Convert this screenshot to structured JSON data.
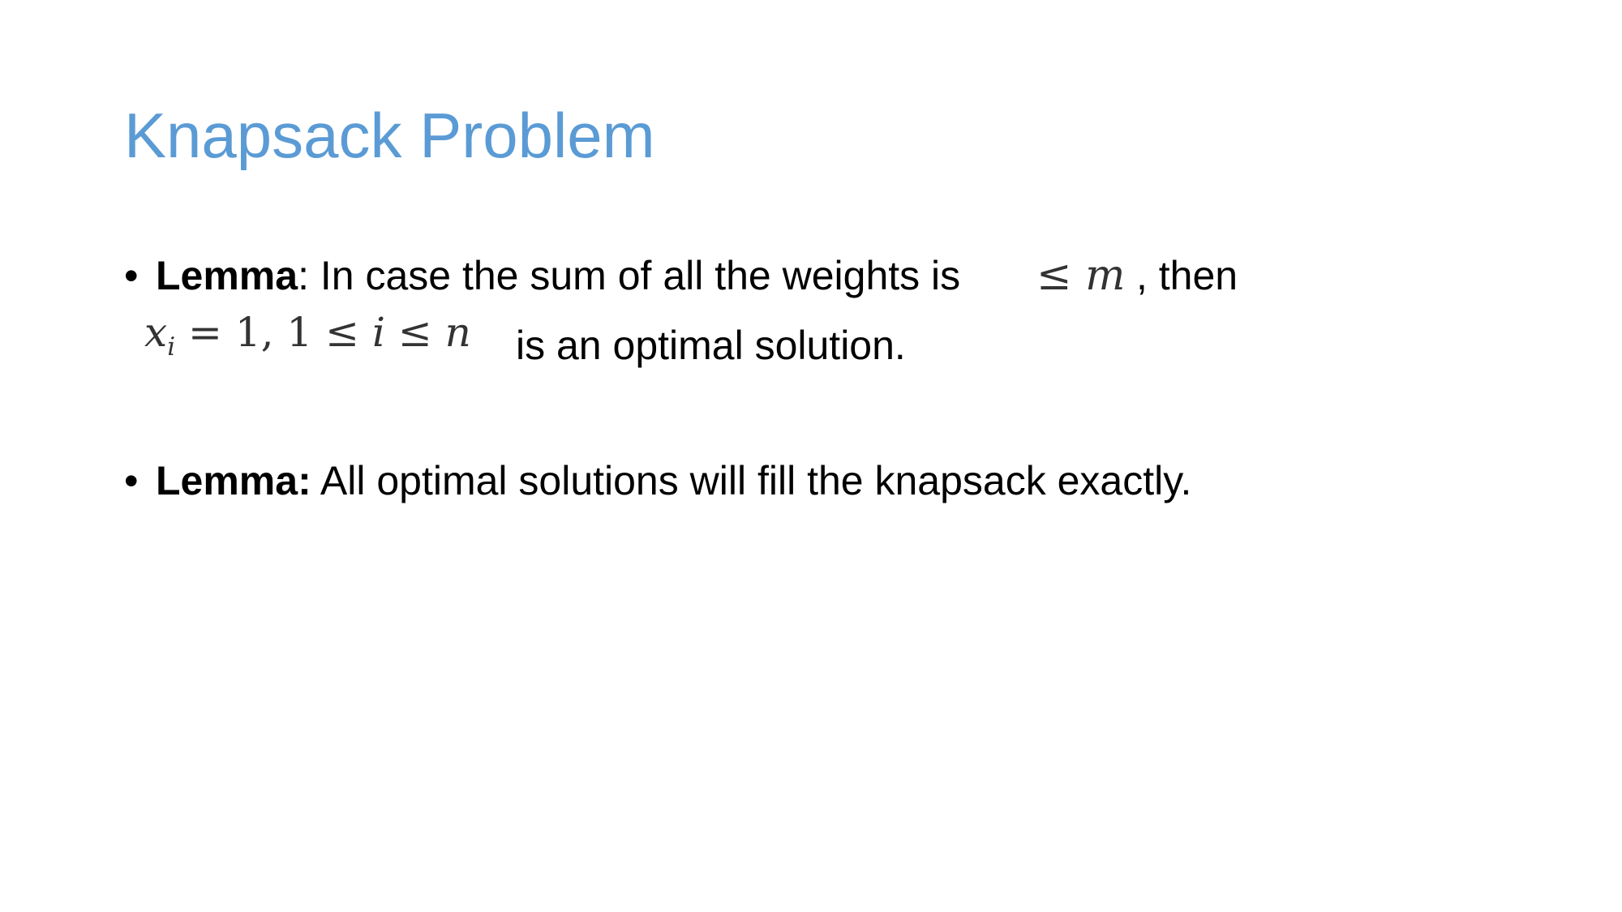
{
  "slide": {
    "title": "Knapsack Problem",
    "title_color": "#5b9bd5",
    "bullet_glyph": "•",
    "bullets": [
      {
        "lead": "Lemma",
        "colon": ":",
        "text_before_math": " In case the sum of all the weights is",
        "math_leq": "≤",
        "math_m": "m",
        "text_after_math": ", then",
        "math2_x": "x",
        "math2_sub": "i",
        "math2_eq": "= 1, 1",
        "math2_leq1": "≤",
        "math2_i": "i",
        "math2_leq2": "≤",
        "math2_n": "n",
        "text_end": "is an optimal solution."
      },
      {
        "lead": "Lemma:",
        "text": " All optimal solutions will fill the knapsack exactly."
      }
    ]
  }
}
